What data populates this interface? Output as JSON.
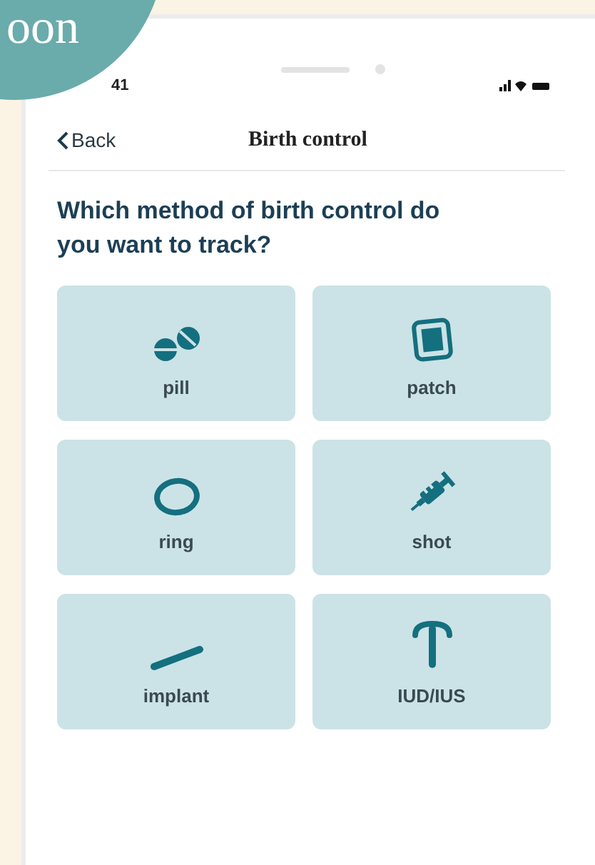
{
  "corner_badge": {
    "text": "oon"
  },
  "status_bar": {
    "time": "41"
  },
  "nav": {
    "back": "Back",
    "title": "Birth control"
  },
  "question": "Which method of birth control do you want to track?",
  "options": [
    {
      "label": "pill",
      "kind": "pill"
    },
    {
      "label": "patch",
      "kind": "patch"
    },
    {
      "label": "ring",
      "kind": "ring"
    },
    {
      "label": "shot",
      "kind": "shot"
    },
    {
      "label": "implant",
      "kind": "implant"
    },
    {
      "label": "IUD/IUS",
      "kind": "iud"
    }
  ]
}
